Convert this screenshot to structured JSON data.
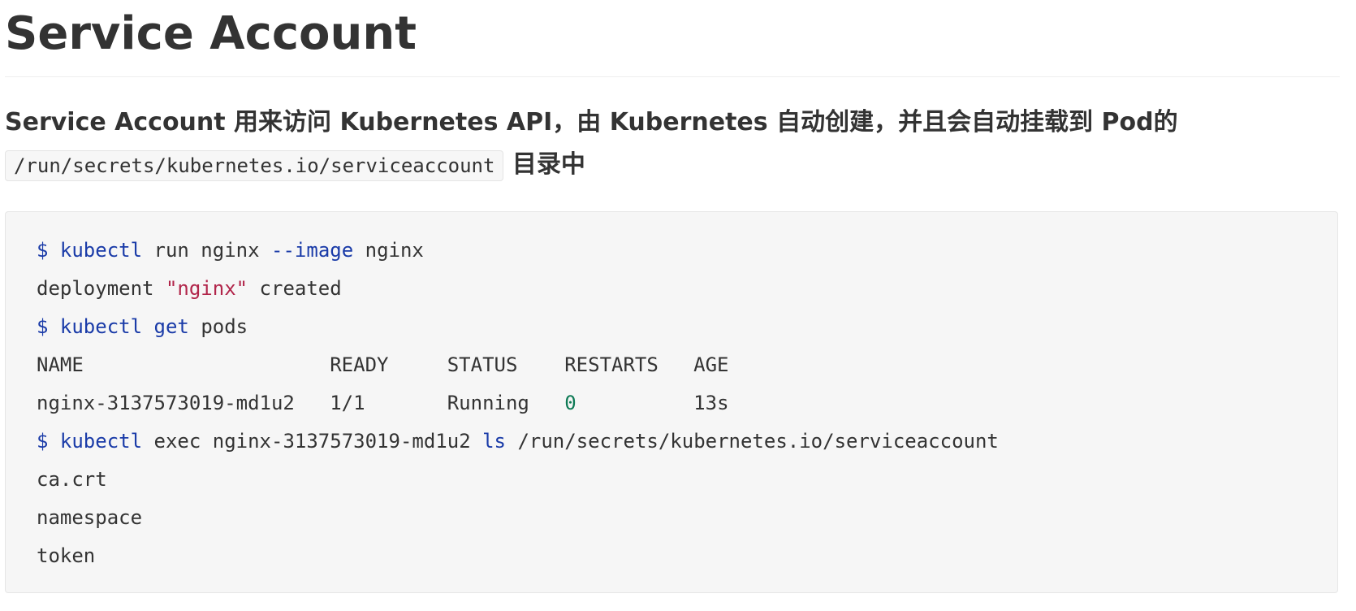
{
  "heading": "Service Account",
  "intro": {
    "text_before": "Service Account 用来访问 Kubernetes API，由 Kubernetes 自动创建，并且会自动挂载到 Pod的",
    "code_path": "/run/secrets/kubernetes.io/serviceaccount",
    "text_after": "目录中"
  },
  "code_lines": [
    [
      {
        "t": "$ ",
        "c": "prompt"
      },
      {
        "t": "kubectl",
        "c": "cmd"
      },
      {
        "t": " run nginx ",
        "c": "plain"
      },
      {
        "t": "--image",
        "c": "kw"
      },
      {
        "t": " nginx",
        "c": "plain"
      }
    ],
    [
      {
        "t": "deployment ",
        "c": "plain"
      },
      {
        "t": "\"nginx\"",
        "c": "str"
      },
      {
        "t": " created",
        "c": "plain"
      }
    ],
    [
      {
        "t": "$ ",
        "c": "prompt"
      },
      {
        "t": "kubectl",
        "c": "cmd"
      },
      {
        "t": " ",
        "c": "plain"
      },
      {
        "t": "get",
        "c": "kw"
      },
      {
        "t": " pods",
        "c": "plain"
      }
    ],
    [
      {
        "t": "NAME                     READY     STATUS    RESTARTS   AGE",
        "c": "plain"
      }
    ],
    [
      {
        "t": "nginx-3137573019-md1u2   1/1       Running   ",
        "c": "plain"
      },
      {
        "t": "0",
        "c": "num"
      },
      {
        "t": "          13s",
        "c": "plain"
      }
    ],
    [
      {
        "t": "$ ",
        "c": "prompt"
      },
      {
        "t": "kubectl",
        "c": "cmd"
      },
      {
        "t": " exec nginx-3137573019-md1u2 ",
        "c": "plain"
      },
      {
        "t": "ls",
        "c": "kw"
      },
      {
        "t": " /run/secrets/kubernetes.io/serviceaccount",
        "c": "plain"
      }
    ],
    [
      {
        "t": "ca.crt",
        "c": "plain"
      }
    ],
    [
      {
        "t": "namespace",
        "c": "plain"
      }
    ],
    [
      {
        "t": "token",
        "c": "plain"
      }
    ]
  ]
}
